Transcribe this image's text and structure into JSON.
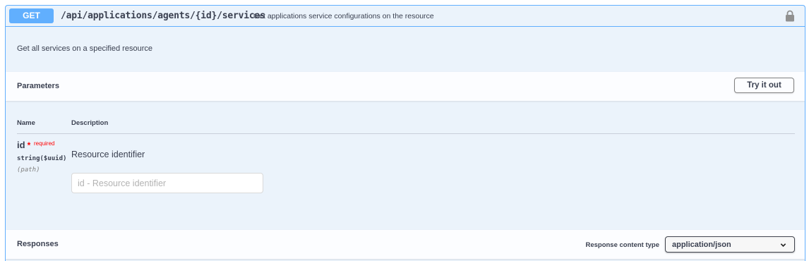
{
  "operation": {
    "method": "GET",
    "path": "/api/applications/agents/{id}/services",
    "summary": "Get applications service configurations on the resource",
    "description": "Get all services on a specified resource",
    "icons": {
      "lock": "lock-icon"
    },
    "colors": {
      "method": "#61affe",
      "background": "#ebf3fb",
      "required": "#ff0000"
    }
  },
  "parameters": {
    "title": "Parameters",
    "try_button": "Try it out",
    "columns": {
      "name": "Name",
      "description": "Description"
    },
    "items": [
      {
        "name": "id",
        "required_mark": "*",
        "required_text": "required",
        "type": "string($uuid)",
        "in": "(path)",
        "description": "Resource identifier",
        "placeholder": "id - Resource identifier"
      }
    ]
  },
  "responses": {
    "title": "Responses",
    "content_type_label": "Response content type",
    "content_type_value": "application/json",
    "icons": {
      "dropdown": "chevron-down-icon"
    }
  }
}
